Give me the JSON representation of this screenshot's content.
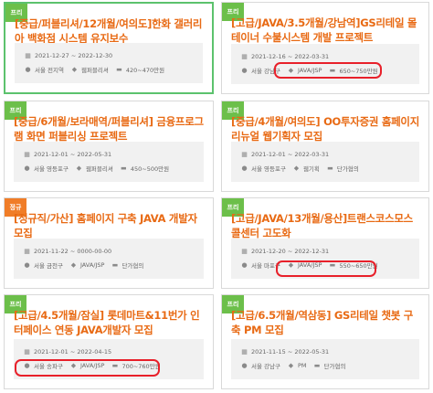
{
  "colors": {
    "accent": "#e86a14",
    "free_badge": "#6cbf4a",
    "regular_badge": "#f07d28",
    "active_border": "#5cc26d",
    "highlight": "#e8202a"
  },
  "cards": [
    {
      "badge": "프리",
      "badge_type": "free",
      "title": "[중급/퍼블리셔/12개월/여의도]한화 갤러리아 백화점 시스템 유지보수",
      "date": "2021-12-27 ~ 2022-12-30",
      "location": "서울 전지역",
      "skill": "웹퍼블리셔",
      "pay": "420~470만원",
      "location_icon": "pin-icon",
      "skill_icon": "tag-icon",
      "pay_icon": "money-icon"
    },
    {
      "badge": "프리",
      "badge_type": "free",
      "title": "[고급/JAVA/3.5개월/강남역]GS리테일 몰테이너 수불시스템 개발 프로젝트",
      "date": "2021-12-16 ~ 2022-03-31",
      "location": "서울 강남구",
      "skill": "JAVA/JSP",
      "pay": "650~750만원",
      "location_icon": "pin-icon",
      "skill_icon": "tag-icon",
      "pay_icon": "money-icon"
    },
    {
      "badge": "프리",
      "badge_type": "free",
      "title": "[중급/6개월/보라매역/퍼블리셔] 금융프로그램 화면 퍼블리싱 프로젝트",
      "date": "2021-12-01 ~ 2022-05-31",
      "location": "서울 영등포구",
      "skill": "웹퍼블리셔",
      "pay": "450~500만원",
      "location_icon": "pin-icon",
      "skill_icon": "tag-icon",
      "pay_icon": "money-icon"
    },
    {
      "badge": "프리",
      "badge_type": "free",
      "title": "[중급/4개월/여의도] OO투자증권 홈페이지 리뉴얼 웹기획자 모집",
      "date": "2021-12-01 ~ 2022-03-31",
      "location": "서울 영등포구",
      "skill": "웹기획",
      "pay": "단가협의",
      "location_icon": "pin-icon",
      "skill_icon": "tag-icon",
      "pay_icon": "money-icon"
    },
    {
      "badge": "정규",
      "badge_type": "regular",
      "title": "[정규직/가산] 홈페이지 구축 JAVA 개발자 모집",
      "date": "2021-11-22 ~ 0000-00-00",
      "location": "서울 금천구",
      "skill": "JAVA/JSP",
      "pay": "단가협의",
      "location_icon": "pin-icon",
      "skill_icon": "tag-icon",
      "pay_icon": "money-icon"
    },
    {
      "badge": "프리",
      "badge_type": "free",
      "title": "[고급/JAVA/13개월/용산]트랜스코스모스 콜센터 고도화",
      "date": "2021-12-20 ~ 2022-12-31",
      "location": "서울 마포구",
      "skill": "JAVA/JSP",
      "pay": "550~650만원",
      "location_icon": "pin-icon",
      "skill_icon": "tag-icon",
      "pay_icon": "money-icon"
    },
    {
      "badge": "프리",
      "badge_type": "free",
      "title": "[고급/4.5개월/잠실] 롯데마트&11번가 인터페이스 연동 JAVA개발자 모집",
      "date": "2021-12-01 ~ 2022-04-15",
      "location": "서울 송파구",
      "skill": "JAVA/JSP",
      "pay": "700~760만원",
      "location_icon": "pin-icon",
      "skill_icon": "tag-icon",
      "pay_icon": "money-icon"
    },
    {
      "badge": "프리",
      "badge_type": "free",
      "title": "[고급/6.5개월/역삼동] GS리테일 챗봇 구축 PM 모집",
      "date": "2021-11-15 ~ 2022-05-31",
      "location": "서울 강남구",
      "skill": "PM",
      "pay": "단가협의",
      "location_icon": "pin-icon",
      "skill_icon": "tag-icon",
      "pay_icon": "money-icon"
    }
  ]
}
